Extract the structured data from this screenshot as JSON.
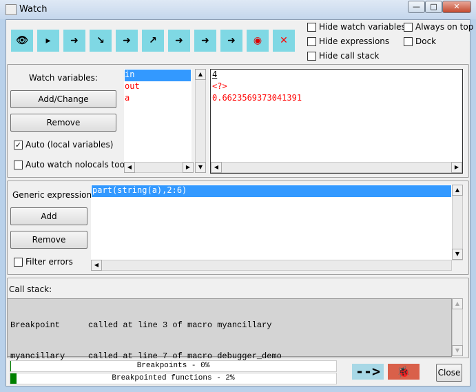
{
  "window": {
    "title": "Watch",
    "minimize": "—",
    "maximize": "□",
    "close": "✕"
  },
  "toolbar": {
    "icons": [
      "watch-eye-icon",
      "step-icon",
      "step-into-icon",
      "step-out-icon",
      "step-over-icon",
      "run-out-icon",
      "run-icon",
      "run-to-cursor-icon",
      "continue-icon",
      "stop-icon",
      "clear-breakpoints-icon"
    ]
  },
  "options": {
    "hide_watch": "Hide watch variables",
    "hide_expr": "Hide expressions",
    "hide_stack": "Hide call stack",
    "always_on_top": "Always on top",
    "dock": "Dock"
  },
  "watch": {
    "label": "Watch variables:",
    "add_change": "Add/Change",
    "remove": "Remove",
    "auto_local": "Auto (local variables)",
    "auto_local_checked": true,
    "auto_nolocals": "Auto watch nolocals too",
    "auto_nolocals_checked": false,
    "names": [
      "in",
      "out",
      "a"
    ],
    "values": [
      "4",
      "<?>",
      "0.6623569373041391"
    ]
  },
  "expressions": {
    "label": "Generic expressions:",
    "add": "Add",
    "remove": "Remove",
    "filter": "Filter errors",
    "items": [
      "part(string(a),2:6)"
    ]
  },
  "callstack": {
    "label": "Call stack:",
    "rows": [
      {
        "name": "Breakpoint",
        "desc": "called at line 3 of macro myancillary"
      },
      {
        "name": "myancillary",
        "desc": "called at line 7 of macro debugger_demo"
      }
    ]
  },
  "progress": {
    "breakpoints": "Breakpoints - 0%",
    "breakpoints_value": 0,
    "functions": "Breakpointed functions - 2%",
    "functions_value": 2,
    "color": "#008000"
  },
  "footer": {
    "arrow": "-->",
    "close": "Close"
  }
}
